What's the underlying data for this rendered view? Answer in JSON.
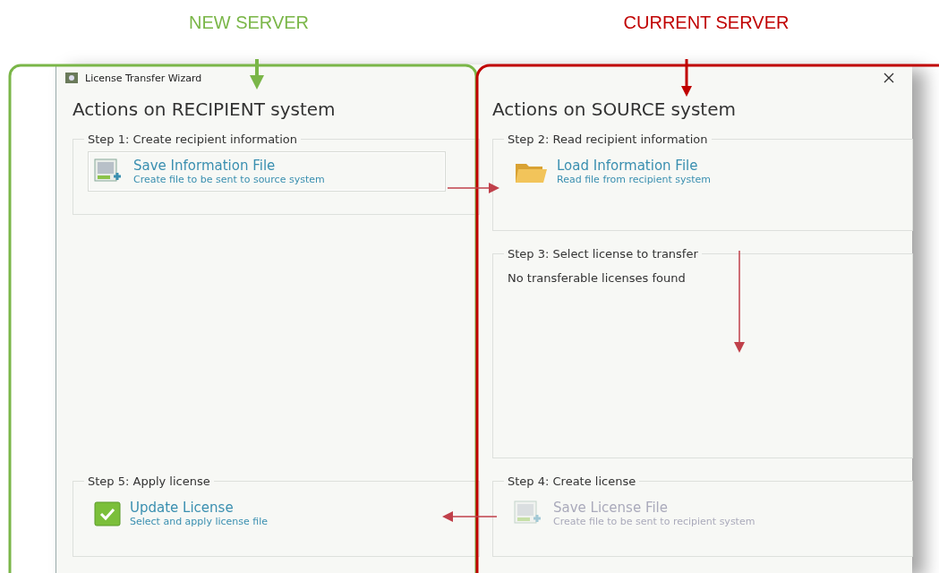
{
  "annotations": [
    {
      "label": "NEW SERVER",
      "color": "#7ab648"
    },
    {
      "label": "CURRENT SERVER",
      "color": "#c00000"
    }
  ],
  "window": {
    "title": "License Transfer Wizard"
  },
  "columns": [
    {
      "heading": "Actions on RECIPIENT system",
      "steps": [
        {
          "kind": "action",
          "title": "Step 1: Create recipient information",
          "action": {
            "kind": "save",
            "title": "Save Information File",
            "subtitle": "Create file to be sent to source system",
            "disabled": false,
            "boxed": true
          }
        },
        {
          "kind": "spacer"
        },
        {
          "kind": "action",
          "title": "Step 5: Apply license",
          "action": {
            "kind": "check",
            "title": "Update License",
            "subtitle": "Select and apply license file",
            "disabled": false,
            "boxed": false
          }
        }
      ]
    },
    {
      "heading": "Actions on SOURCE system",
      "steps": [
        {
          "kind": "action",
          "title": "Step 2: Read recipient information",
          "action": {
            "kind": "folder",
            "title": "Load Information File",
            "subtitle": "Read file from recipient system",
            "disabled": false,
            "boxed": false
          }
        },
        {
          "kind": "message",
          "title": "Step 3: Select license to transfer",
          "message": "No transferable licenses found"
        },
        {
          "kind": "action",
          "title": "Step 4: Create license",
          "action": {
            "kind": "save",
            "title": "Save License File",
            "subtitle": "Create file to be sent to recipient system",
            "disabled": true,
            "boxed": false
          }
        }
      ]
    }
  ]
}
